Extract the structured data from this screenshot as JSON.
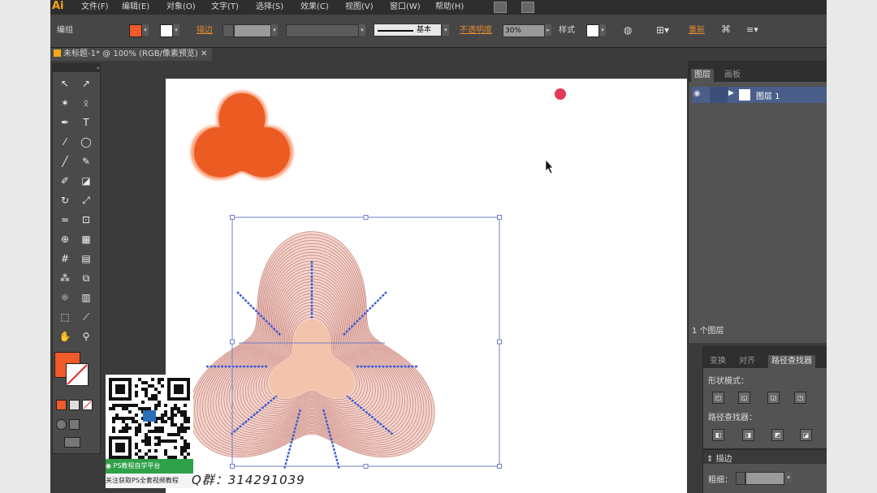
{
  "app": {
    "logo": "Ai",
    "menu": [
      "文件(F)",
      "编辑(E)",
      "对象(O)",
      "文字(T)",
      "选择(S)",
      "效果(C)",
      "视图(V)",
      "窗口(W)",
      "帮助(H)"
    ]
  },
  "control": {
    "mode_label": "编组",
    "fill_color": "#f15a29",
    "stroke_link": "描边",
    "stroke_profile": "基本",
    "opacity_link": "不透明度",
    "opacity_value": "30%",
    "style_label": "样式",
    "recolor_link": "重新"
  },
  "document": {
    "tab_title": "未标题-1* @ 100% (RGB/像素预览)"
  },
  "tools": {
    "collapse": "«",
    "items": [
      {
        "name": "selection-tool",
        "glyph": "↖"
      },
      {
        "name": "direct-selection-tool",
        "glyph": "↗"
      },
      {
        "name": "magic-wand-tool",
        "glyph": "✶"
      },
      {
        "name": "lasso-tool",
        "glyph": "ᛟ"
      },
      {
        "name": "pen-tool",
        "glyph": "✒"
      },
      {
        "name": "type-tool",
        "glyph": "T"
      },
      {
        "name": "line-tool",
        "glyph": "⁄"
      },
      {
        "name": "ellipse-tool",
        "glyph": "◯"
      },
      {
        "name": "paintbrush-tool",
        "glyph": "╱"
      },
      {
        "name": "pencil-tool",
        "glyph": "✎"
      },
      {
        "name": "blob-brush-tool",
        "glyph": "✐"
      },
      {
        "name": "eraser-tool",
        "glyph": "◪"
      },
      {
        "name": "rotate-tool",
        "glyph": "↻"
      },
      {
        "name": "scale-tool",
        "glyph": "⤢"
      },
      {
        "name": "warp-tool",
        "glyph": "≈"
      },
      {
        "name": "free-transform-tool",
        "glyph": "⊡"
      },
      {
        "name": "shape-builder-tool",
        "glyph": "⊕"
      },
      {
        "name": "perspective-grid-tool",
        "glyph": "▦"
      },
      {
        "name": "mesh-tool",
        "glyph": "#"
      },
      {
        "name": "gradient-tool",
        "glyph": "▤"
      },
      {
        "name": "eyedropper-tool",
        "glyph": "⁂"
      },
      {
        "name": "blend-tool",
        "glyph": "⧉"
      },
      {
        "name": "symbol-sprayer-tool",
        "glyph": "☼"
      },
      {
        "name": "column-graph-tool",
        "glyph": "▥"
      },
      {
        "name": "artboard-tool",
        "glyph": "⬚"
      },
      {
        "name": "slice-tool",
        "glyph": "⟋"
      },
      {
        "name": "hand-tool",
        "glyph": "✋"
      },
      {
        "name": "zoom-tool",
        "glyph": "⚲"
      }
    ]
  },
  "layers_panel": {
    "tab_active": "图层",
    "tab_other": "画板",
    "layer_name": "图层 1",
    "footer": "1 个图层"
  },
  "pathfinder_panel": {
    "tabs": [
      "变换",
      "对齐",
      "路径查找器"
    ],
    "shape_modes_label": "形状模式：",
    "pathfinders_label": "路径查找器："
  },
  "stroke_panel": {
    "title": "描边",
    "weight_label": "粗细："
  },
  "watermark": {
    "green_text": "PS教程自学平台",
    "white_text": "关注获取PS全套视频教程",
    "qq_text": "Q群：314291039"
  },
  "colors": {
    "shape_orange": "#ec5b22",
    "center_pink": "#f4c3ab",
    "rings": "#c9857c",
    "selection": "#6f7fc8",
    "dot": "#e23a55"
  }
}
